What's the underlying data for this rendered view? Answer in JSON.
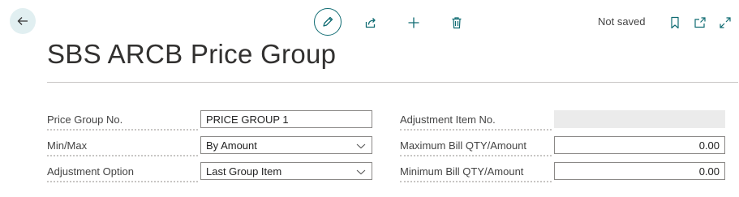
{
  "toolbar": {
    "status": "Not saved",
    "icons": [
      "back-arrow-icon",
      "pencil-icon",
      "share-icon",
      "plus-icon",
      "trash-icon",
      "bookmark-icon",
      "open-new-window-icon",
      "expand-icon"
    ]
  },
  "page": {
    "title": "SBS ARCB Price Group"
  },
  "left_fields": [
    {
      "label": "Price Group No.",
      "value": "PRICE GROUP 1"
    },
    {
      "label": "Min/Max",
      "value": "By Amount"
    },
    {
      "label": "Adjustment Option",
      "value": "Last Group Item"
    }
  ],
  "right_fields": [
    {
      "label": "Adjustment Item No.",
      "value": ""
    },
    {
      "label": "Maximum Bill QTY/Amount",
      "value": "0.00"
    },
    {
      "label": "Minimum Bill QTY/Amount",
      "value": "0.00"
    }
  ],
  "colors": {
    "accent": "#0f6b72",
    "back_bg": "#e1eff1"
  }
}
